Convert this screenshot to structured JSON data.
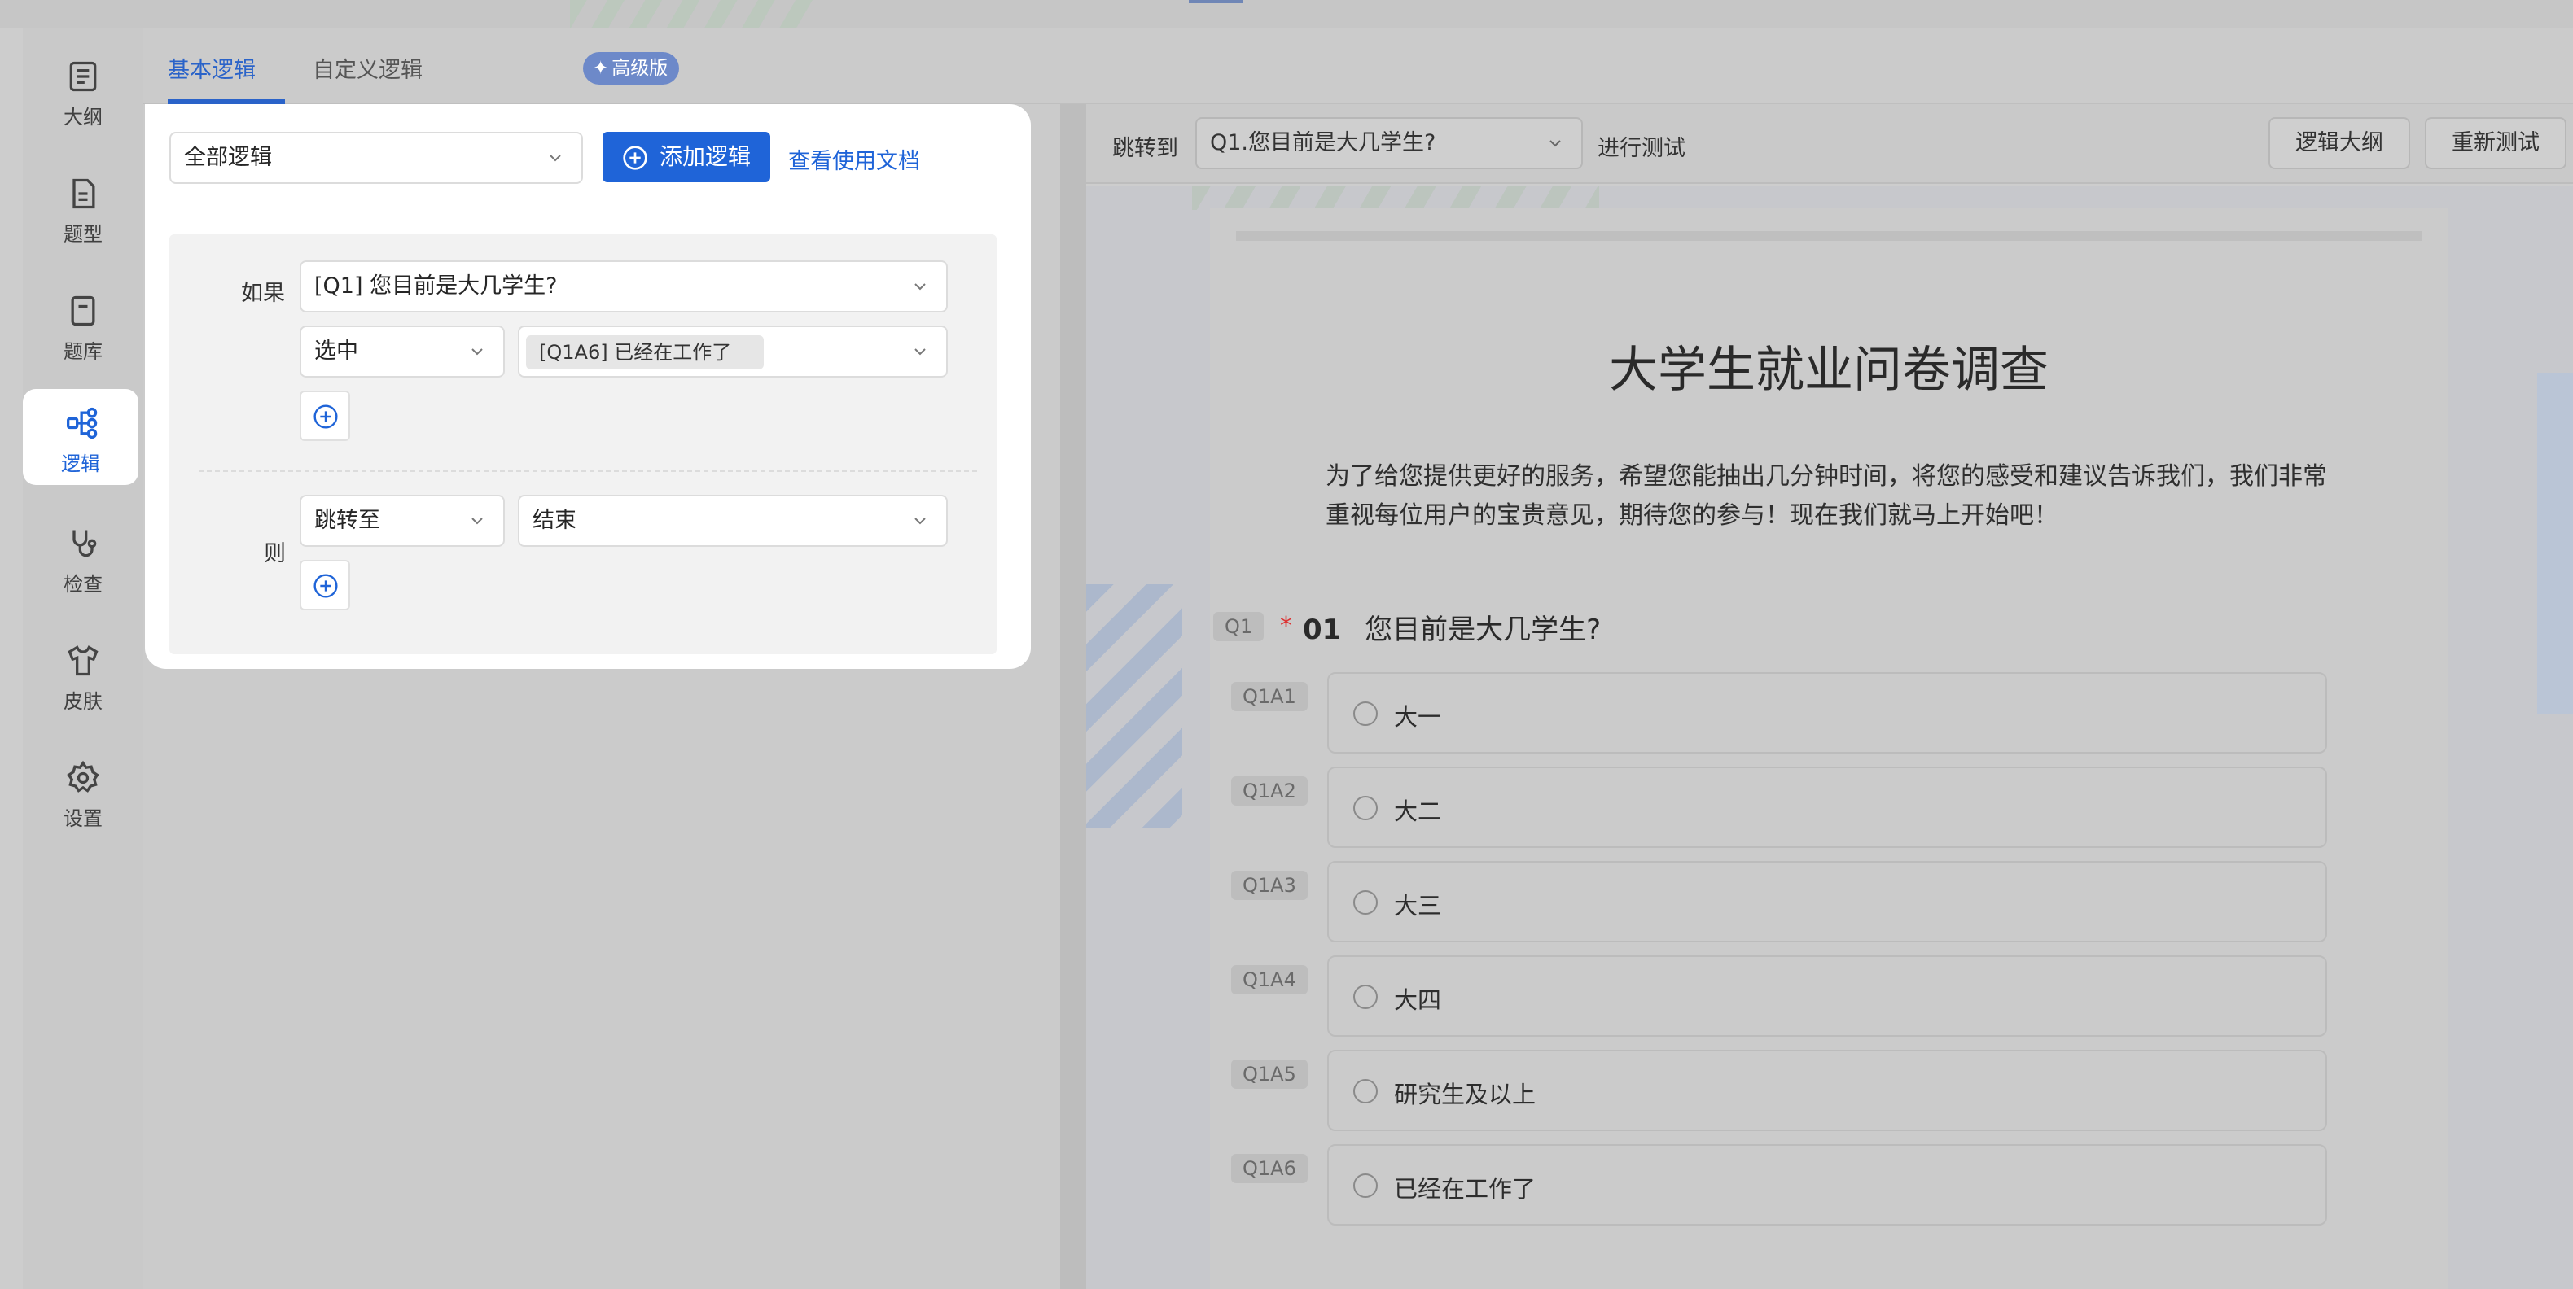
{
  "sidebar": {
    "items": [
      {
        "label": "大纲",
        "icon": "outline-icon",
        "active": false
      },
      {
        "label": "题型",
        "icon": "question-type-icon",
        "active": false
      },
      {
        "label": "题库",
        "icon": "question-bank-icon",
        "active": false
      },
      {
        "label": "逻辑",
        "icon": "logic-icon",
        "active": true
      },
      {
        "label": "检查",
        "icon": "check-icon",
        "active": false
      },
      {
        "label": "皮肤",
        "icon": "skin-icon",
        "active": false
      },
      {
        "label": "设置",
        "icon": "settings-icon",
        "active": false
      }
    ]
  },
  "tabs": {
    "basic": "基本逻辑",
    "custom": "自定义逻辑",
    "badge": "高级版"
  },
  "logic_panel": {
    "filter_select": "全部逻辑",
    "add_button": "添加逻辑",
    "doc_link": "查看使用文档",
    "if_label": "如果",
    "if_question": "[Q1] 您目前是大几学生?",
    "condition_select": "选中",
    "condition_tag": "[Q1A6] 已经在工作了",
    "then_label": "则",
    "action_select": "跳转至",
    "target_select": "结束"
  },
  "toolbar": {
    "jump_to_label": "跳转到",
    "jump_select": "Q1.您目前是大几学生?",
    "test_label": "进行测试",
    "logic_outline_button": "逻辑大纲",
    "retest_button": "重新测试"
  },
  "survey": {
    "title": "大学生就业问卷调查",
    "description": "为了给您提供更好的服务，希望您能抽出几分钟时间，将您的感受和建议告诉我们，我们非常重视每位用户的宝贵意见，期待您的参与！现在我们就马上开始吧！",
    "question": {
      "tag": "Q1",
      "required_mark": "*",
      "number": "01",
      "text": "您目前是大几学生?",
      "options": [
        {
          "tag": "Q1A1",
          "label": "大一"
        },
        {
          "tag": "Q1A2",
          "label": "大二"
        },
        {
          "tag": "Q1A3",
          "label": "大三"
        },
        {
          "tag": "Q1A4",
          "label": "大四"
        },
        {
          "tag": "Q1A5",
          "label": "研究生及以上"
        },
        {
          "tag": "Q1A6",
          "label": "已经在工作了"
        }
      ]
    }
  },
  "colors": {
    "accent": "#1f64d8",
    "active_tab": "#2a63c9",
    "required": "#dd3333"
  }
}
